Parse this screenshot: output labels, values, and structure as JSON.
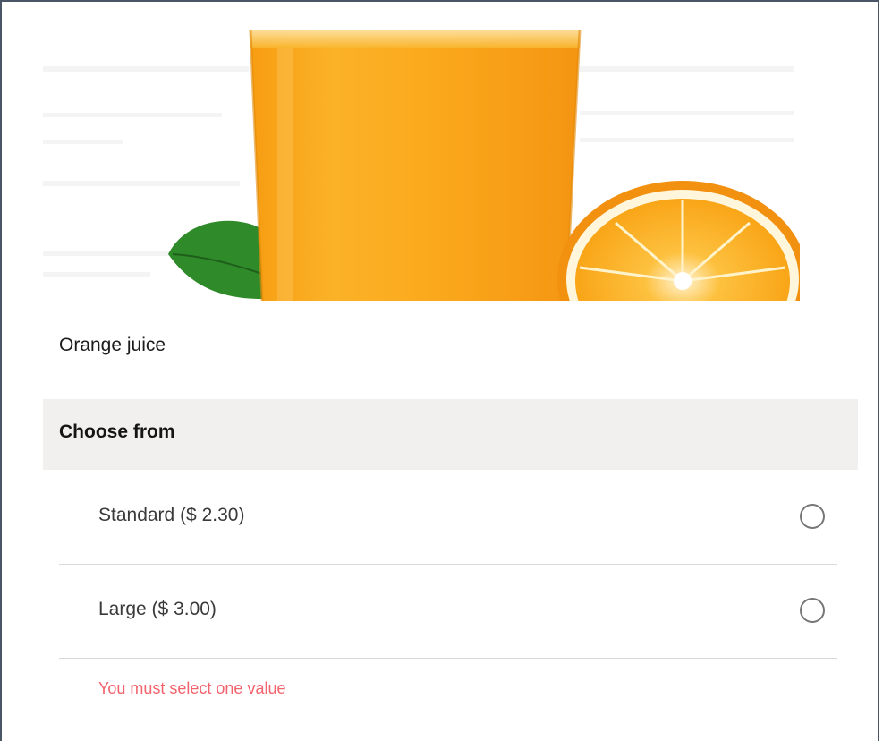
{
  "product": {
    "image_icon": "orange-juice-photo",
    "name": "Orange juice"
  },
  "choices": {
    "title": "Choose from",
    "options": [
      {
        "label": "Standard ($ 2.30)",
        "selected": false
      },
      {
        "label": "Large ($ 3.00)",
        "selected": false
      }
    ],
    "error": "You must select one value"
  },
  "colors": {
    "border": "#4a5566",
    "section_bg": "#f1f0ef",
    "error": "#f2636d",
    "juice": "#f9a21a",
    "orange_rind": "#f7a416",
    "leaf": "#2f8a2a"
  }
}
